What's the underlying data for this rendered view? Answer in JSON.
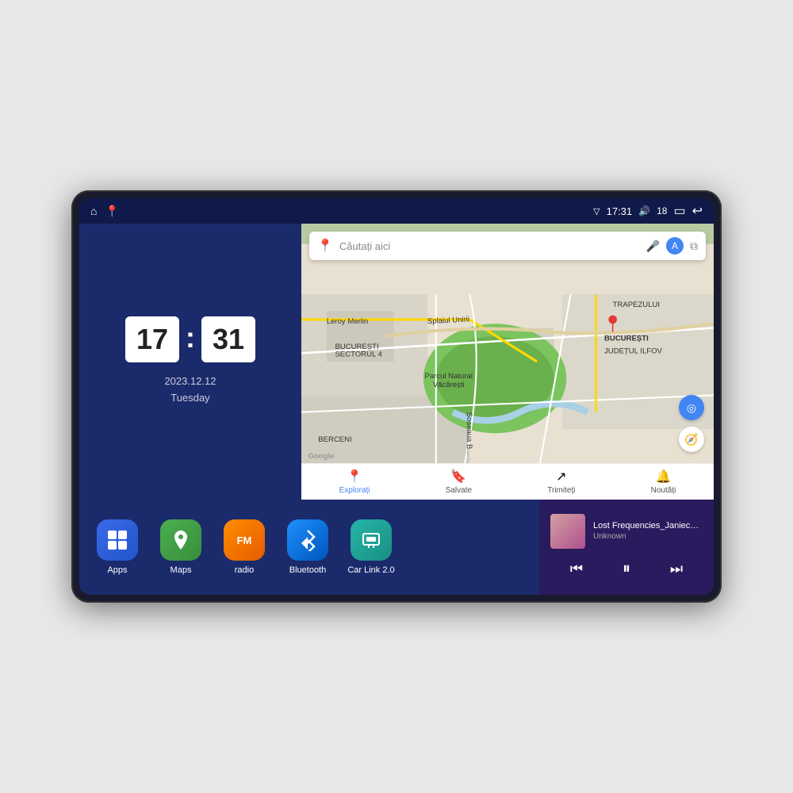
{
  "device": {
    "status_bar": {
      "signal_icon": "▽",
      "time": "17:31",
      "volume_icon": "🔊",
      "battery_level": "18",
      "battery_icon": "▭",
      "back_icon": "↩",
      "home_icon": "⌂",
      "maps_nav_icon": "📍"
    },
    "clock": {
      "hour": "17",
      "minute": "31",
      "date": "2023.12.12",
      "day": "Tuesday"
    },
    "map": {
      "search_placeholder": "Căutați aici",
      "nav_items": [
        {
          "label": "Explorați",
          "active": true
        },
        {
          "label": "Salvate",
          "active": false
        },
        {
          "label": "Trimiteți",
          "active": false
        },
        {
          "label": "Noutăți",
          "active": false
        }
      ],
      "labels": [
        "BUCUREȘTI",
        "JUDEȚUL ILFOV",
        "BERCENI",
        "TRAPEZULUI",
        "Parcul Natural Văcărești",
        "Leroy Merlin",
        "BUCUREȘTI\nSECTORUL 4"
      ]
    },
    "apps": [
      {
        "id": "apps",
        "label": "Apps",
        "icon_class": "icon-apps",
        "icon": "⊞"
      },
      {
        "id": "maps",
        "label": "Maps",
        "icon_class": "icon-maps",
        "icon": "📍"
      },
      {
        "id": "radio",
        "label": "radio",
        "icon_class": "icon-radio",
        "icon": "FM"
      },
      {
        "id": "bluetooth",
        "label": "Bluetooth",
        "icon_class": "icon-bluetooth",
        "icon": "⚡"
      },
      {
        "id": "carlink",
        "label": "Car Link 2.0",
        "icon_class": "icon-carlink",
        "icon": "📱"
      }
    ],
    "music": {
      "title": "Lost Frequencies_Janieck Devy-...",
      "artist": "Unknown",
      "prev_icon": "⏮",
      "play_icon": "⏸",
      "next_icon": "⏭"
    }
  }
}
